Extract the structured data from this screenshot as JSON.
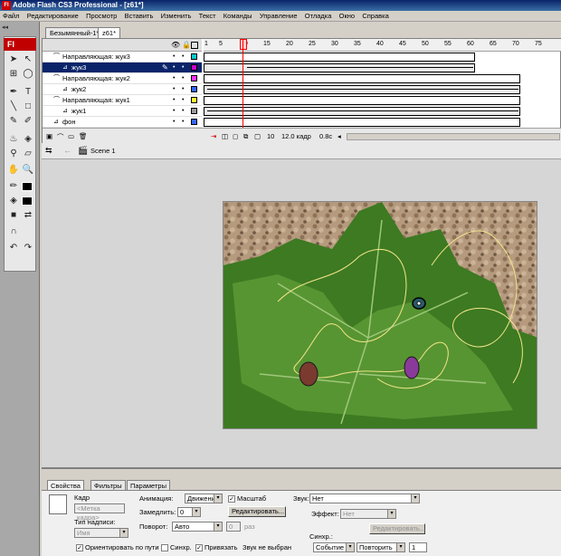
{
  "window": {
    "title": "Adobe Flash CS3 Professional - [z61*]",
    "logo_text": "Fl"
  },
  "menu": [
    "Файл",
    "Редактирование",
    "Просмотр",
    "Вставить",
    "Изменить",
    "Текст",
    "Команды",
    "Управление",
    "Отладка",
    "Окно",
    "Справка"
  ],
  "doc_tabs": [
    "Безымянный-1*",
    "z61*"
  ],
  "timeline": {
    "ruler": [
      "1",
      "5",
      "10",
      "15",
      "20",
      "25",
      "30",
      "35",
      "40",
      "45",
      "50",
      "55",
      "60",
      "65",
      "70",
      "75"
    ],
    "layers": [
      {
        "name": "Направляющая: жук3",
        "color": "#00cccc",
        "guide": true
      },
      {
        "name": "жук3",
        "color": "#cc00cc",
        "guide": false,
        "selected": true
      },
      {
        "name": "Направляющая: жук2",
        "color": "#ff33ff",
        "guide": true
      },
      {
        "name": "жук2",
        "color": "#3366ff",
        "guide": false
      },
      {
        "name": "Направляющая: жук1",
        "color": "#ffff33",
        "guide": true
      },
      {
        "name": "жук1",
        "color": "#999999",
        "guide": false
      },
      {
        "name": "фон",
        "color": "#3366ff",
        "guide": false
      }
    ],
    "footer": {
      "frame": "10",
      "fps": "12.0 кадр",
      "time": "0.8с"
    }
  },
  "editbar": {
    "scene": "Scene 1"
  },
  "properties": {
    "tabs": [
      "Свойства",
      "Фильтры",
      "Параметры"
    ],
    "frame_label": "Кадр",
    "frame_placeholder": "<Метка кадра>",
    "label_type_caption": "Тип надписи:",
    "label_type_value": "Имя",
    "animation_label": "Анимация:",
    "animation_value": "Движение",
    "scale_label": "Масштаб",
    "ease_label": "Замедлить:",
    "ease_value": "0",
    "edit_button": "Редактировать...",
    "rotation_label": "Поворот:",
    "rotation_value": "Авто",
    "rotation_count": "0",
    "rotation_unit": "раз",
    "orient_label": "Ориентировать по пути",
    "sync_label": "Синхр.",
    "snap_label": "Привязать",
    "sound_label": "Звук:",
    "sound_value": "Нет",
    "effect_label": "Эффект:",
    "effect_value": "Нет",
    "sound_edit_button": "Редактировать...",
    "sync_sound_label": "Синхр.:",
    "event_value": "Событие",
    "repeat_value": "Повторить",
    "repeat_count": "1",
    "no_sound_text": "Звук не выбран"
  }
}
